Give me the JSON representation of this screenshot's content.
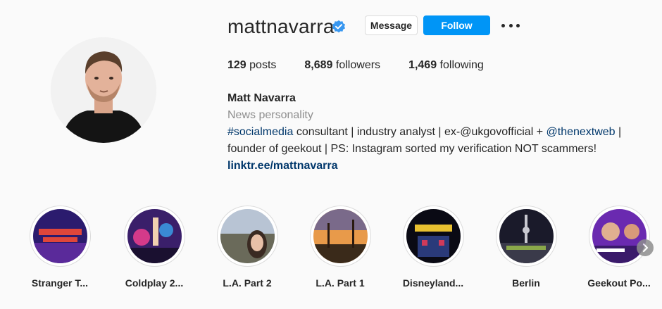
{
  "profile": {
    "username": "mattnavarra",
    "verified": true,
    "message_label": "Message",
    "follow_label": "Follow",
    "stats": {
      "posts_count": "129",
      "posts_label": "posts",
      "followers_count": "8,689",
      "followers_label": "followers",
      "following_count": "1,469",
      "following_label": "following"
    },
    "full_name": "Matt Navarra",
    "category": "News personality",
    "bio": {
      "hashtag": "#socialmedia",
      "line1_rest": " consultant | industry analyst | ex-@ukgovofficial + ",
      "mention": "@thenextweb",
      "line1_end": " |",
      "line2": "founder of geekout | PS: Instagram sorted my verification NOT scammers!"
    },
    "link": "linktr.ee/mattnavarra"
  },
  "highlights": [
    {
      "label": "Stranger T..."
    },
    {
      "label": "Coldplay 2..."
    },
    {
      "label": "L.A. Part 2"
    },
    {
      "label": "L.A. Part 1"
    },
    {
      "label": "Disneyland..."
    },
    {
      "label": "Berlin"
    },
    {
      "label": "Geekout Po..."
    }
  ],
  "colors": {
    "accent": "#0095f6",
    "link": "#00376b",
    "verified": "#3897f0",
    "muted": "#8e8e8e"
  }
}
